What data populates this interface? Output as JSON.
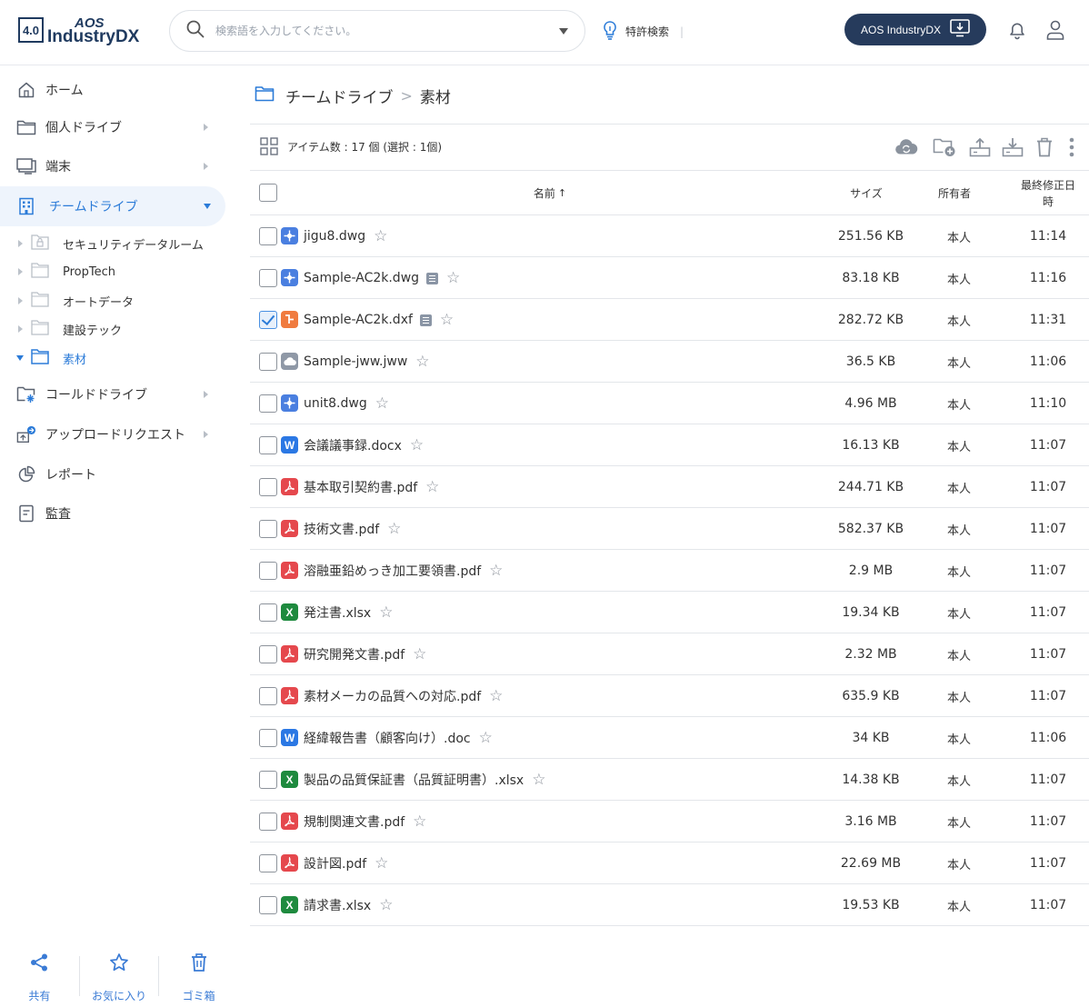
{
  "header": {
    "logo_badge": "4.0",
    "logo_top": "AOS",
    "logo_bottom": "IndustryDX",
    "search_placeholder": "検索語を入力してください。",
    "patent_search": "特許検索",
    "separator": "|",
    "app_button": "AOS IndustryDX"
  },
  "sidebar": {
    "items": [
      {
        "label": "ホーム",
        "icon": "home-icon"
      },
      {
        "label": "個人ドライブ",
        "icon": "folder-icon"
      },
      {
        "label": "端末",
        "icon": "monitor-icon"
      },
      {
        "label": "チームドライブ",
        "icon": "building-icon"
      },
      {
        "label": "コールドドライブ",
        "icon": "cold-drive-icon"
      },
      {
        "label": "アップロードリクエスト",
        "icon": "upload-request-icon"
      },
      {
        "label": "レポート",
        "icon": "pie-chart-icon"
      },
      {
        "label": "監査",
        "icon": "audit-icon"
      }
    ],
    "team_folders": [
      {
        "label": "セキュリティデータルーム",
        "icon": "lock-folder-icon"
      },
      {
        "label": "PropTech",
        "icon": "folder-icon"
      },
      {
        "label": "オートデータ",
        "icon": "folder-icon"
      },
      {
        "label": "建設テック",
        "icon": "folder-icon"
      },
      {
        "label": "素材",
        "icon": "folder-icon"
      }
    ],
    "bottom": {
      "share": "共有",
      "favorites": "お気に入り",
      "trash": "ゴミ箱"
    }
  },
  "breadcrumb": {
    "root": "チームドライブ",
    "sep": ">",
    "current": "素材"
  },
  "toolbar": {
    "item_count": "アイテム数 : 17 個 (選択 : 1個)"
  },
  "table": {
    "columns": {
      "name": "名前",
      "size": "サイズ",
      "owner": "所有者",
      "modified_line1": "最終修正日",
      "modified_line2": "時"
    },
    "rows": [
      {
        "name": "jigu8.dwg",
        "type": "cad",
        "size": "251.56 KB",
        "owner": "本人",
        "time": "11:14",
        "checked": false,
        "note": false
      },
      {
        "name": "Sample-AC2k.dwg",
        "type": "cad",
        "size": "83.18 KB",
        "owner": "本人",
        "time": "11:16",
        "checked": false,
        "note": true
      },
      {
        "name": "Sample-AC2k.dxf",
        "type": "dxf",
        "size": "282.72 KB",
        "owner": "本人",
        "time": "11:31",
        "checked": true,
        "note": true
      },
      {
        "name": "Sample-jww.jww",
        "type": "cloud",
        "size": "36.5 KB",
        "owner": "本人",
        "time": "11:06",
        "checked": false,
        "note": false
      },
      {
        "name": "unit8.dwg",
        "type": "cad",
        "size": "4.96 MB",
        "owner": "本人",
        "time": "11:10",
        "checked": false,
        "note": false
      },
      {
        "name": "会議議事録.docx",
        "type": "word",
        "size": "16.13 KB",
        "owner": "本人",
        "time": "11:07",
        "checked": false,
        "note": false
      },
      {
        "name": "基本取引契約書.pdf",
        "type": "pdf",
        "size": "244.71 KB",
        "owner": "本人",
        "time": "11:07",
        "checked": false,
        "note": false
      },
      {
        "name": "技術文書.pdf",
        "type": "pdf",
        "size": "582.37 KB",
        "owner": "本人",
        "time": "11:07",
        "checked": false,
        "note": false
      },
      {
        "name": "溶融亜鉛めっき加工要領書.pdf",
        "type": "pdf",
        "size": "2.9 MB",
        "owner": "本人",
        "time": "11:07",
        "checked": false,
        "note": false
      },
      {
        "name": "発注書.xlsx",
        "type": "excel",
        "size": "19.34 KB",
        "owner": "本人",
        "time": "11:07",
        "checked": false,
        "note": false
      },
      {
        "name": "研究開発文書.pdf",
        "type": "pdf",
        "size": "2.32 MB",
        "owner": "本人",
        "time": "11:07",
        "checked": false,
        "note": false
      },
      {
        "name": "素材メーカの品質への対応.pdf",
        "type": "pdf",
        "size": "635.9 KB",
        "owner": "本人",
        "time": "11:07",
        "checked": false,
        "note": false
      },
      {
        "name": "経緯報告書（顧客向け）.doc",
        "type": "word",
        "size": "34 KB",
        "owner": "本人",
        "time": "11:06",
        "checked": false,
        "note": false
      },
      {
        "name": "製品の品質保証書（品質証明書）.xlsx",
        "type": "excel",
        "size": "14.38 KB",
        "owner": "本人",
        "time": "11:07",
        "checked": false,
        "note": false
      },
      {
        "name": "規制関連文書.pdf",
        "type": "pdf",
        "size": "3.16 MB",
        "owner": "本人",
        "time": "11:07",
        "checked": false,
        "note": false
      },
      {
        "name": "設計図.pdf",
        "type": "pdf",
        "size": "22.69 MB",
        "owner": "本人",
        "time": "11:07",
        "checked": false,
        "note": false
      },
      {
        "name": "請求書.xlsx",
        "type": "excel",
        "size": "19.53 KB",
        "owner": "本人",
        "time": "11:07",
        "checked": false,
        "note": false
      }
    ]
  },
  "colors": {
    "accent": "#2b7bd8",
    "brand_dark": "#263b5c",
    "cad": "#4a7fe0",
    "dxf": "#f07b3f",
    "cloud": "#8f98a6",
    "word": "#2b78e4",
    "pdf": "#e5484d",
    "excel": "#1e8a3e"
  }
}
